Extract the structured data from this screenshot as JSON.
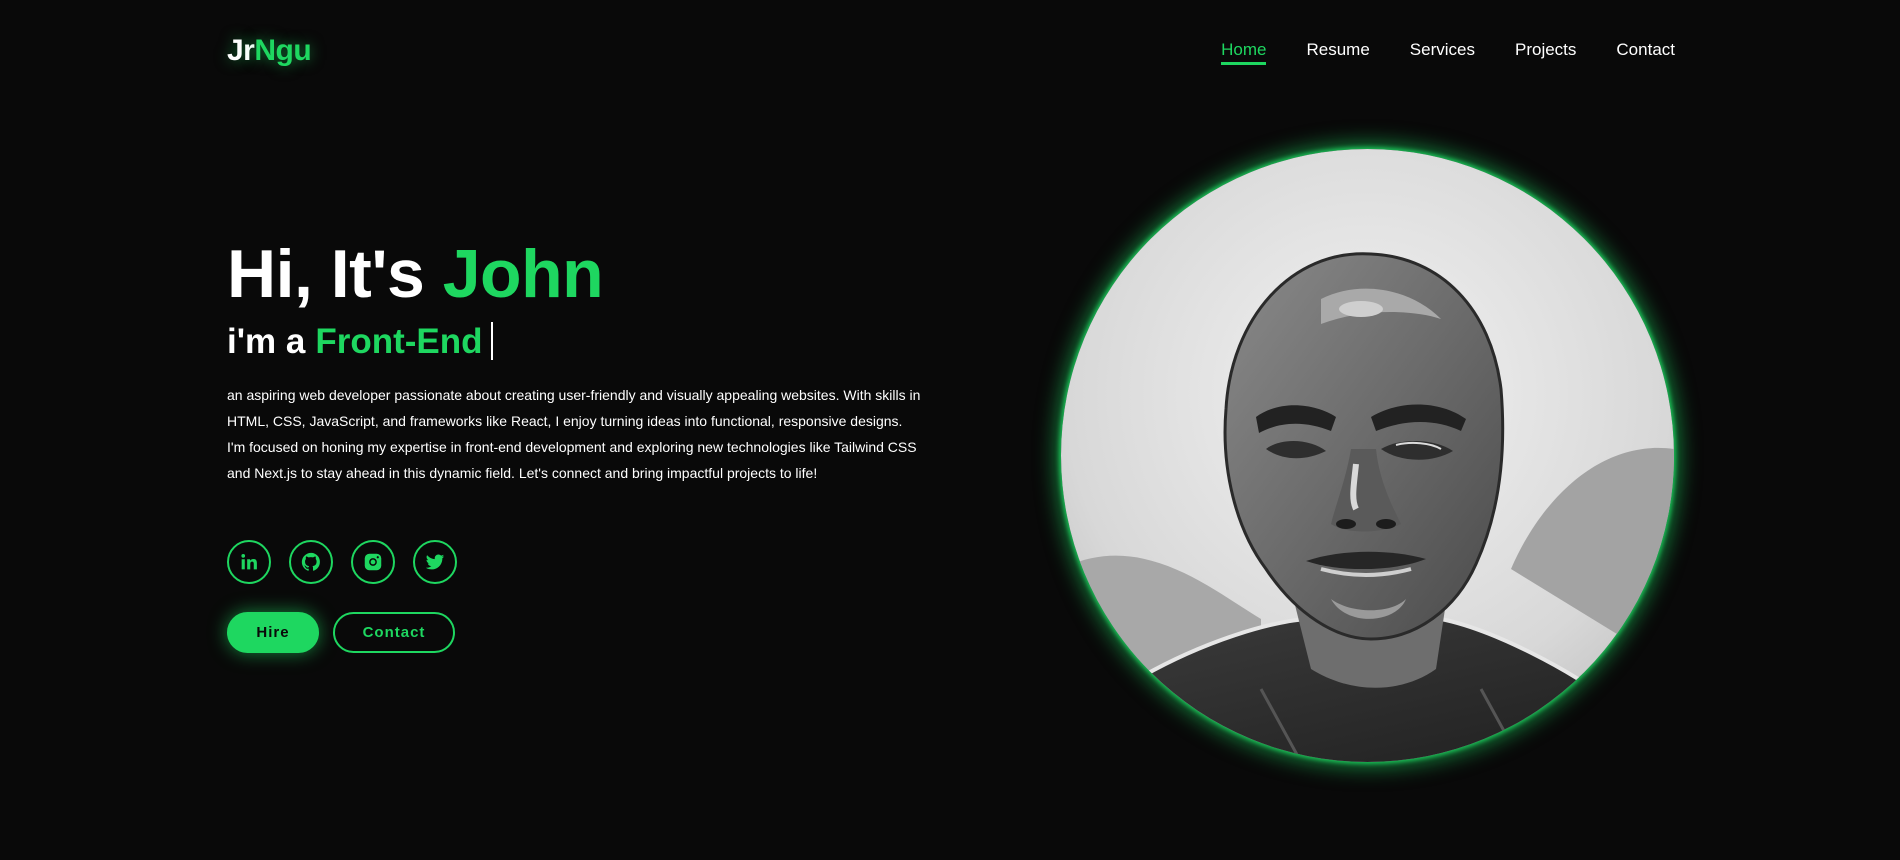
{
  "header": {
    "logo_part1": "Jr",
    "logo_part2": "Ngu",
    "nav": [
      {
        "label": "Home",
        "active": true
      },
      {
        "label": "Resume",
        "active": false
      },
      {
        "label": "Services",
        "active": false
      },
      {
        "label": "Projects",
        "active": false
      },
      {
        "label": "Contact",
        "active": false
      }
    ]
  },
  "hero": {
    "greeting": "Hi, It's",
    "name": "John",
    "role_prefix": "i'm a",
    "role": "Front-End",
    "description": "an aspiring web developer passionate about creating user-friendly and visually appealing websites. With skills in HTML, CSS, JavaScript, and frameworks like React, I enjoy turning ideas into functional, responsive designs. I'm focused on honing my expertise in front-end development and exploring new technologies like Tailwind CSS and Next.js to stay ahead in this dynamic field. Let's connect and bring impactful projects to life!",
    "socials": [
      {
        "icon": "linkedin-icon"
      },
      {
        "icon": "github-icon"
      },
      {
        "icon": "instagram-icon"
      },
      {
        "icon": "twitter-icon"
      }
    ],
    "hire_label": "Hire",
    "contact_label": "Contact"
  },
  "colors": {
    "accent": "#1ed760",
    "background": "#090909",
    "text": "#ffffff"
  }
}
